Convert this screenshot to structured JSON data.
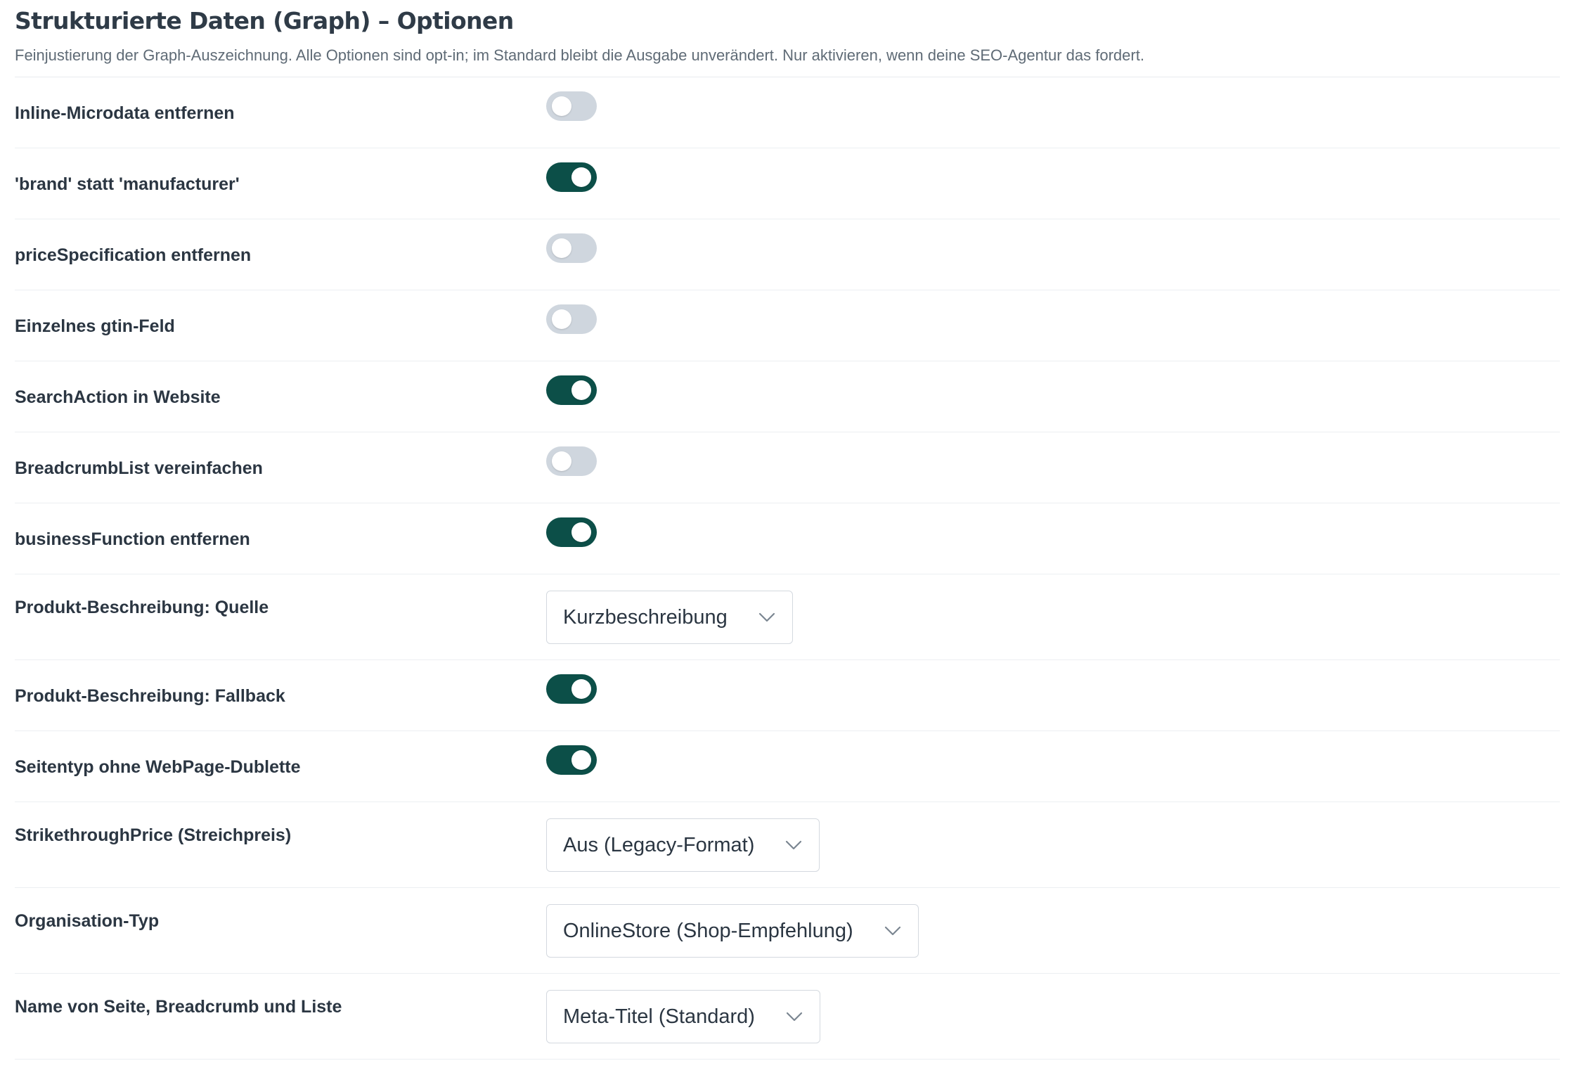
{
  "header": {
    "title": "Strukturierte Daten (Graph) – Optionen",
    "description": "Feinjustierung der Graph-Auszeichnung. Alle Optionen sind opt-in; im Standard bleibt die Ausgabe unverändert. Nur aktivieren, wenn deine SEO-Agentur das fordert."
  },
  "colors": {
    "toggle_on": "#0c4f48",
    "toggle_off": "#cfd6de"
  },
  "options": [
    {
      "label": "Inline-Microdata entfernen",
      "type": "toggle",
      "checked": false
    },
    {
      "label": "'brand' statt 'manufacturer'",
      "type": "toggle",
      "checked": true
    },
    {
      "label": "priceSpecification entfernen",
      "type": "toggle",
      "checked": false
    },
    {
      "label": "Einzelnes gtin-Feld",
      "type": "toggle",
      "checked": false
    },
    {
      "label": "SearchAction in Website",
      "type": "toggle",
      "checked": true
    },
    {
      "label": "BreadcrumbList vereinfachen",
      "type": "toggle",
      "checked": false
    },
    {
      "label": "businessFunction entfernen",
      "type": "toggle",
      "checked": true
    },
    {
      "label": "Produkt-Beschreibung: Quelle",
      "type": "select",
      "value": "Kurzbeschreibung"
    },
    {
      "label": "Produkt-Beschreibung: Fallback",
      "type": "toggle",
      "checked": true
    },
    {
      "label": "Seitentyp ohne WebPage-Dublette",
      "type": "toggle",
      "checked": true
    },
    {
      "label": "StrikethroughPrice (Streichpreis)",
      "type": "select",
      "value": "Aus (Legacy-Format)"
    },
    {
      "label": "Organisation-Typ",
      "type": "select",
      "value": "OnlineStore (Shop-Empfehlung)"
    },
    {
      "label": "Name von Seite, Breadcrumb und Liste",
      "type": "select",
      "value": "Meta-Titel (Standard)"
    }
  ]
}
